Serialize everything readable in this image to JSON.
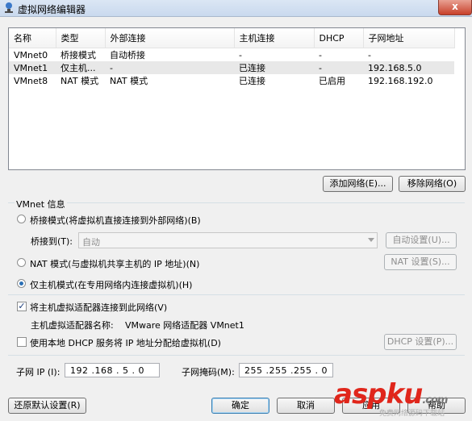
{
  "window": {
    "title": "虚拟网络编辑器",
    "close_glyph": "x"
  },
  "table": {
    "columns": [
      "名称",
      "类型",
      "外部连接",
      "主机连接",
      "DHCP",
      "子网地址"
    ],
    "rows": [
      [
        "VMnet0",
        "桥接模式",
        "自动桥接",
        "-",
        "-",
        "-"
      ],
      [
        "VMnet1",
        "仅主机...",
        "-",
        "已连接",
        "-",
        "192.168.5.0"
      ],
      [
        "VMnet8",
        "NAT 模式",
        "NAT 模式",
        "已连接",
        "已启用",
        "192.168.192.0"
      ]
    ],
    "selected_row": 1
  },
  "buttons": {
    "add_network": "添加网络(E)...",
    "remove_network": "移除网络(O)",
    "auto_settings": "自动设置(U)...",
    "nat_settings": "NAT 设置(S)...",
    "dhcp_settings": "DHCP 设置(P)...",
    "restore_defaults": "还原默认设置(R)",
    "ok": "确定",
    "cancel": "取消",
    "apply": "应用",
    "help": "帮助"
  },
  "vmnet_info": {
    "group_title": "VMnet 信息",
    "bridged_label": "桥接模式(将虚拟机直接连接到外部网络)(B)",
    "bridge_to_label": "桥接到(T):",
    "bridge_to_value": "自动",
    "nat_label": "NAT 模式(与虚拟机共享主机的 IP 地址)(N)",
    "host_only_label": "仅主机模式(在专用网络内连接虚拟机)(H)",
    "selected_mode": "host-only",
    "connect_adapter_label": "将主机虚拟适配器连接到此网络(V)",
    "connect_adapter_checked": true,
    "adapter_name_label": "主机虚拟适配器名称:",
    "adapter_name_value": "VMware 网络适配器 VMnet1",
    "dhcp_label": "使用本地 DHCP 服务将 IP 地址分配给虚拟机(D)",
    "dhcp_checked": false,
    "subnet_ip_label": "子网 IP (I):",
    "subnet_ip_value": "192 .168 . 5  . 0",
    "subnet_mask_label": "子网掩码(M):",
    "subnet_mask_value": "255 .255 .255 . 0"
  },
  "watermark": {
    "brand": "asp",
    "brand2": "ku",
    "brand_tld": ".com",
    "subtitle": "免费网络源码下载站"
  },
  "colors": {
    "watermark_red": "#e0261b",
    "selection": "#e8e8e8",
    "title_bar": "#c9d9ee"
  }
}
